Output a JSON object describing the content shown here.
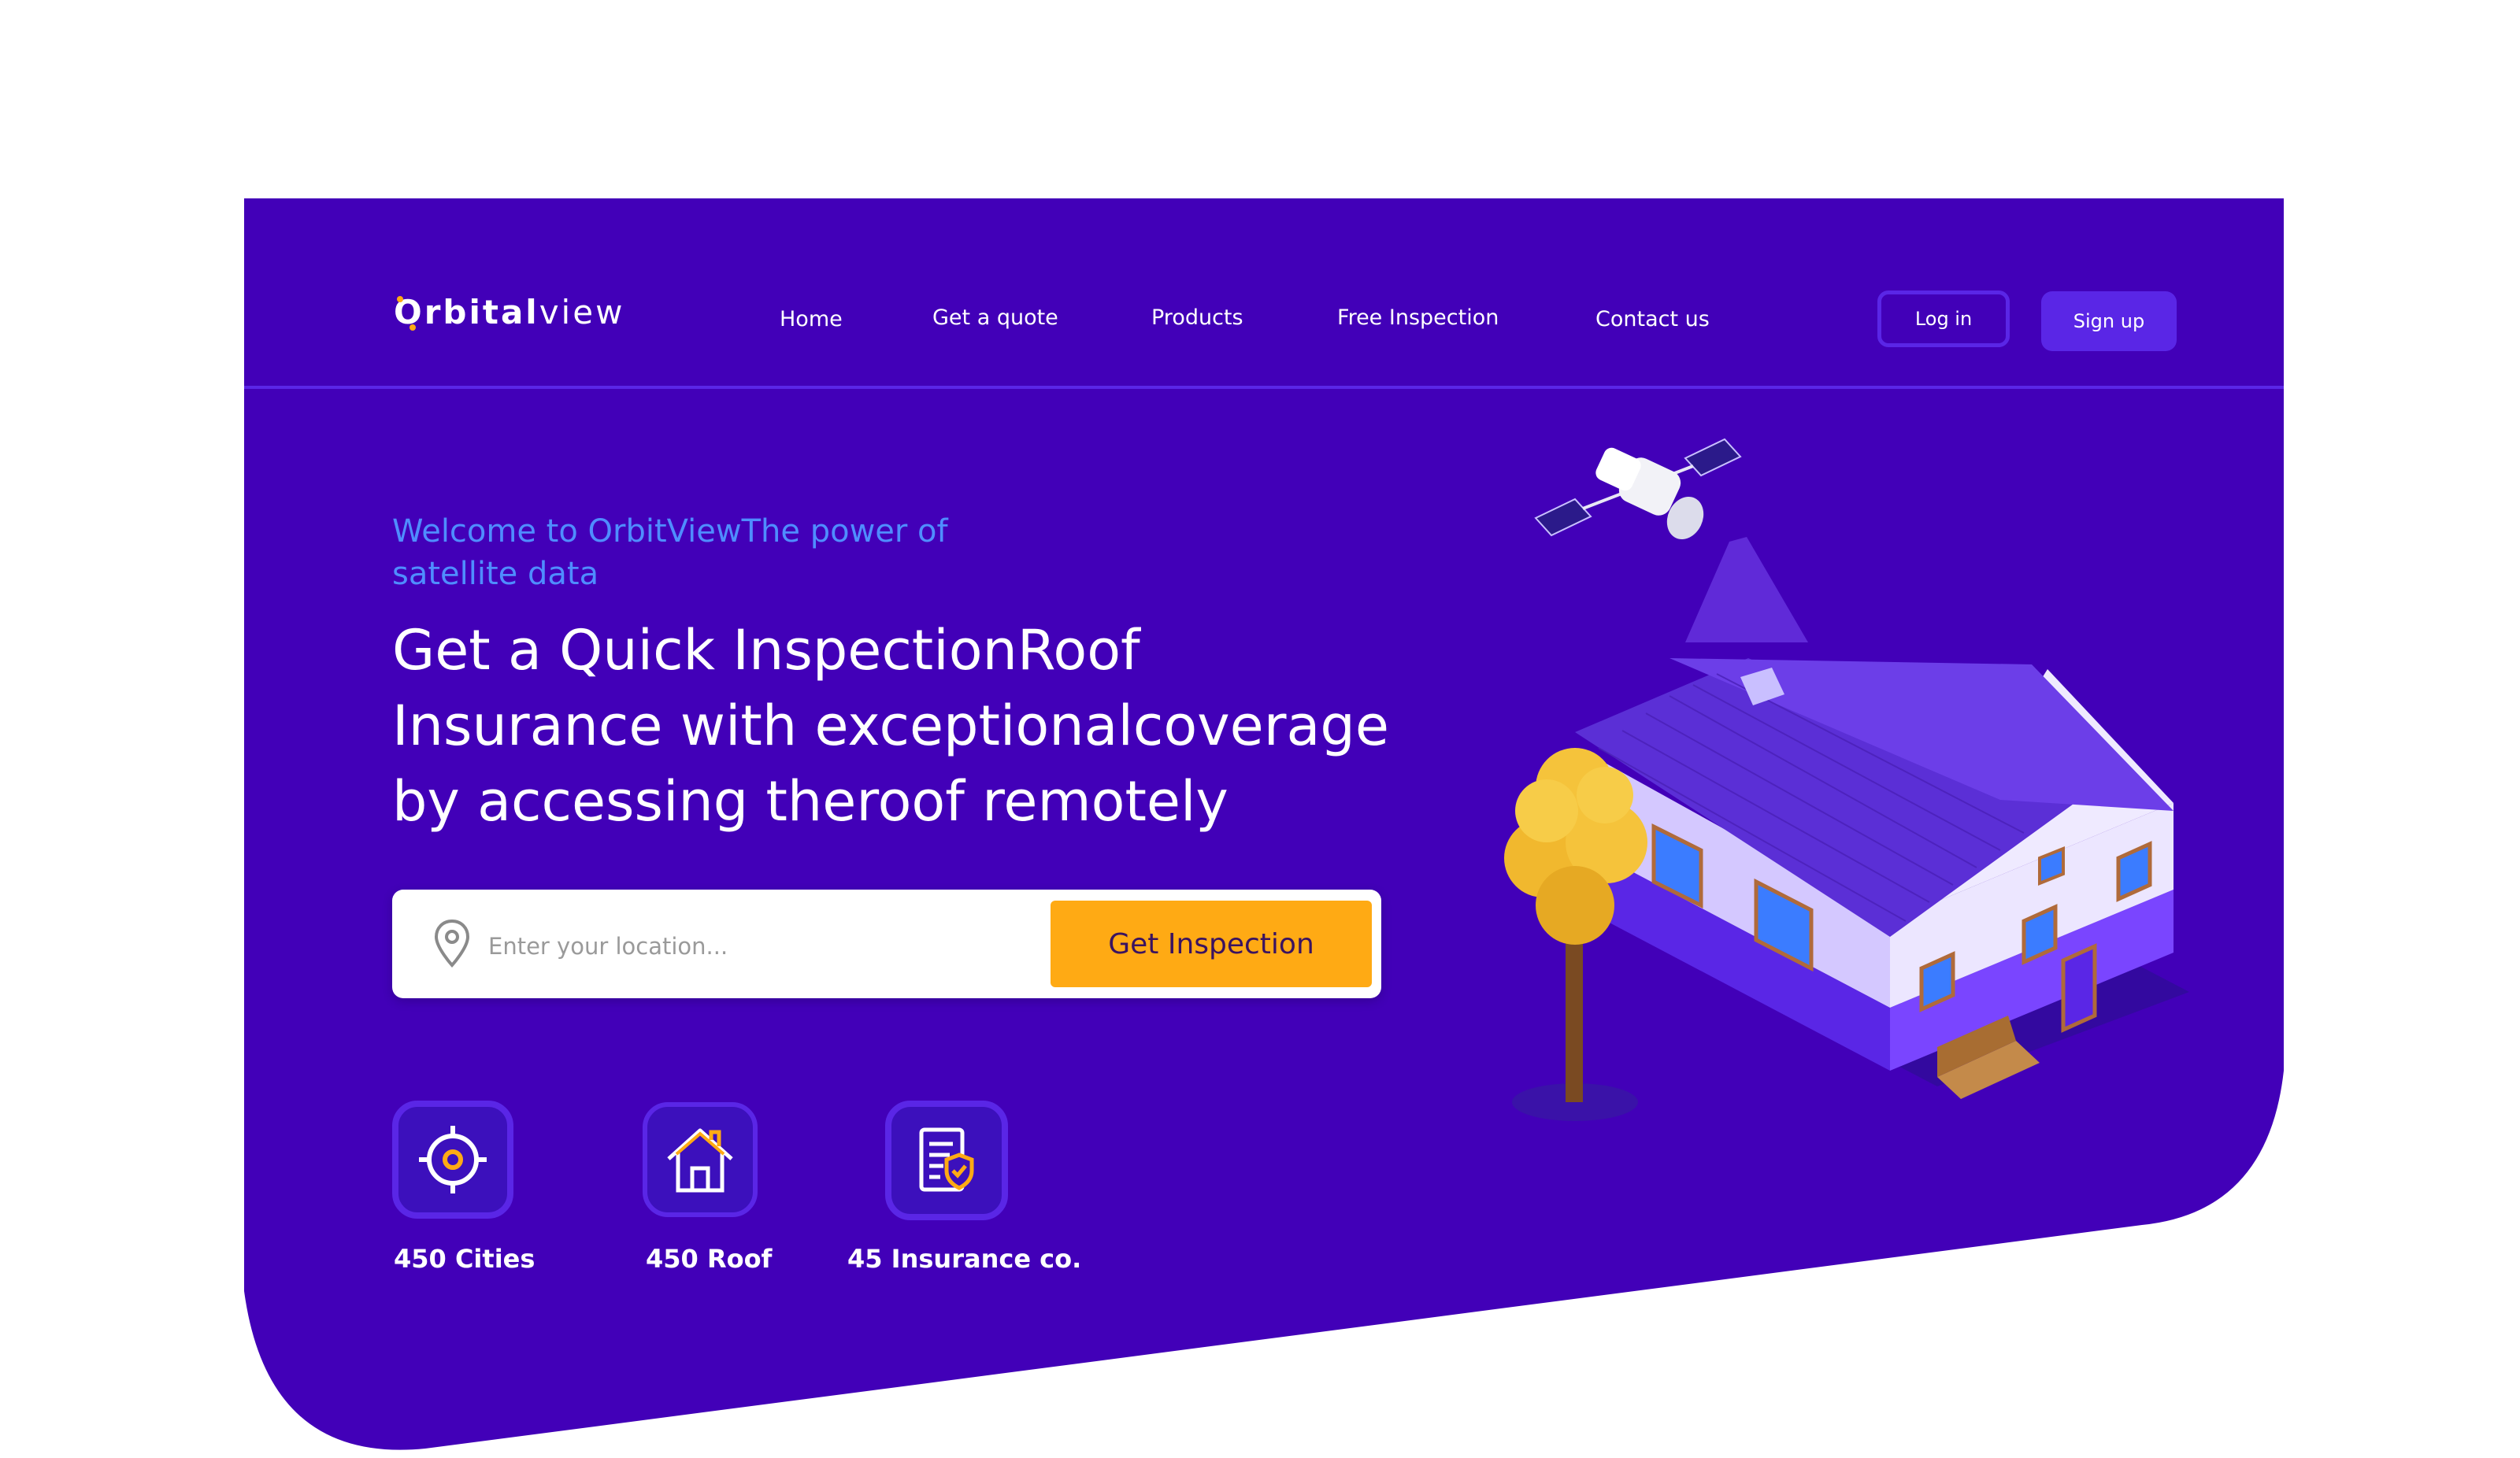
{
  "brand": {
    "name_bold": "Orbital",
    "name_light": "view",
    "accent_color": "#ffaa14"
  },
  "colors": {
    "background": "#4200b8",
    "accent": "#5a26e6",
    "cta": "#ffaa14"
  },
  "nav": {
    "items": [
      {
        "label": "Home"
      },
      {
        "label": "Get a quote"
      },
      {
        "label": "Products"
      },
      {
        "label": "Free Inspection"
      },
      {
        "label": "Contact us"
      }
    ],
    "login_label": "Log in",
    "signup_label": "Sign up"
  },
  "hero": {
    "welcome": "Welcome to OrbitViewThe power of satellite data",
    "headline": "Get a Quick InspectionRoof Insurance with exceptionalcoverage by accessing theroof remotely"
  },
  "search": {
    "placeholder": "Enter your location...",
    "button_label": "Get Inspection",
    "icon": "location-pin-icon"
  },
  "stats": [
    {
      "label": "450 Cities",
      "icon": "target-icon"
    },
    {
      "label": "450 Roof",
      "icon": "house-icon"
    },
    {
      "label": "45 Insurance co.",
      "icon": "insurance-document-icon"
    }
  ]
}
